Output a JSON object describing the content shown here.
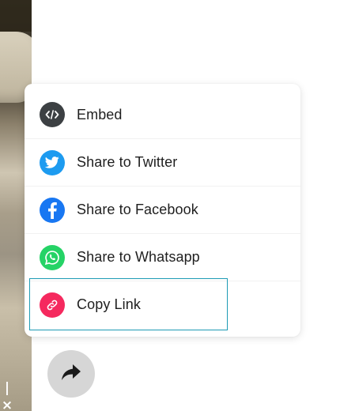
{
  "video": {
    "close_symbol": "|×"
  },
  "share_menu": {
    "items": [
      {
        "label": "Embed",
        "icon": "embed-code-icon",
        "color": "#3c4043"
      },
      {
        "label": "Share to Twitter",
        "icon": "twitter-icon",
        "color": "#1d9bf0"
      },
      {
        "label": "Share to Facebook",
        "icon": "facebook-icon",
        "color": "#1877f2"
      },
      {
        "label": "Share to Whatsapp",
        "icon": "whatsapp-icon",
        "color": "#25d366"
      },
      {
        "label": "Copy Link",
        "icon": "link-icon",
        "color": "#f5295e"
      }
    ],
    "focused_item": "Copy Link"
  },
  "share_button": {
    "icon": "share-arrow-icon",
    "color": "#d6d6d6"
  },
  "colors": {
    "focus_ring": "#1e9bb5",
    "text": "#1f1f1f"
  }
}
